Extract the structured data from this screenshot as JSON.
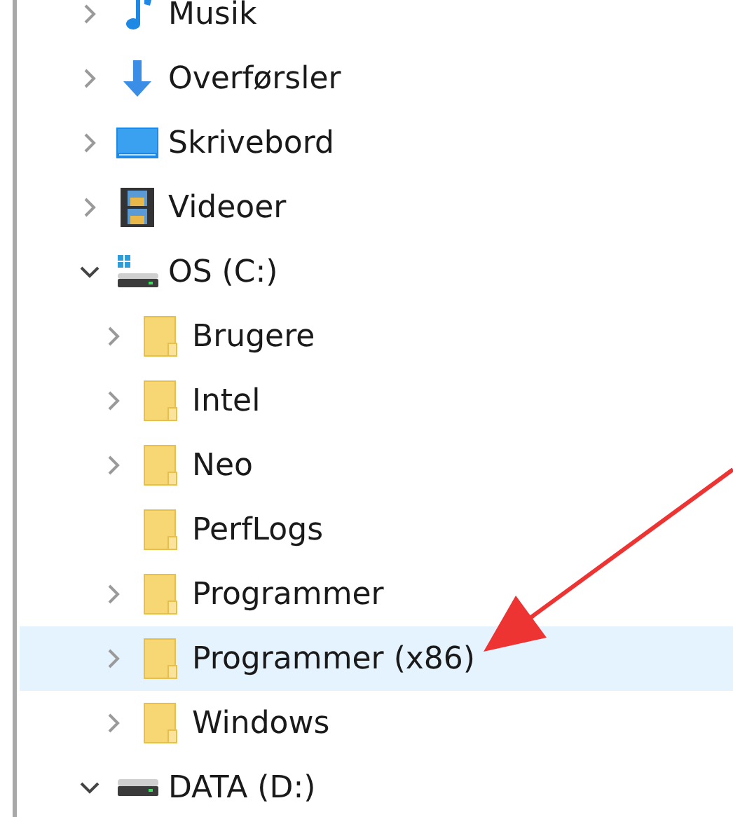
{
  "tree": [
    {
      "label": "Musik",
      "kind": "music",
      "expandable": true,
      "expanded": false,
      "selected": false
    },
    {
      "label": "Overførsler",
      "kind": "download",
      "expandable": true,
      "expanded": false,
      "selected": false
    },
    {
      "label": "Skrivebord",
      "kind": "desktop",
      "expandable": true,
      "expanded": false,
      "selected": false
    },
    {
      "label": "Videoer",
      "kind": "video",
      "expandable": true,
      "expanded": false,
      "selected": false
    },
    {
      "label": "OS (C:)",
      "kind": "system-drive",
      "expandable": true,
      "expanded": true,
      "selected": false,
      "children": [
        {
          "label": "Brugere",
          "kind": "folder",
          "expandable": true,
          "expanded": false,
          "selected": false
        },
        {
          "label": "Intel",
          "kind": "folder",
          "expandable": true,
          "expanded": false,
          "selected": false
        },
        {
          "label": "Neo",
          "kind": "folder",
          "expandable": true,
          "expanded": false,
          "selected": false
        },
        {
          "label": "PerfLogs",
          "kind": "folder",
          "expandable": false,
          "expanded": false,
          "selected": false
        },
        {
          "label": "Programmer",
          "kind": "folder",
          "expandable": true,
          "expanded": false,
          "selected": false
        },
        {
          "label": "Programmer (x86)",
          "kind": "folder",
          "expandable": true,
          "expanded": false,
          "selected": true
        },
        {
          "label": "Windows",
          "kind": "folder",
          "expandable": true,
          "expanded": false,
          "selected": false
        }
      ]
    },
    {
      "label": "DATA (D:)",
      "kind": "drive",
      "expandable": true,
      "expanded": true,
      "selected": false
    }
  ]
}
